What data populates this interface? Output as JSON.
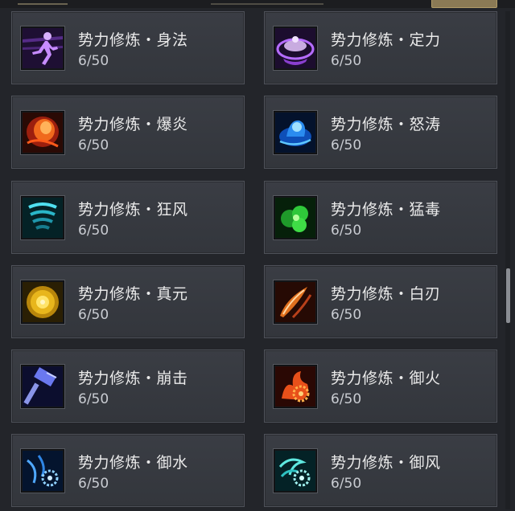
{
  "skills": [
    {
      "name": "势力修炼・身法",
      "progress": "6/50",
      "icon": "running-figure-icon",
      "color": "#a35ae0"
    },
    {
      "name": "势力修炼・定力",
      "progress": "6/50",
      "icon": "meditation-figure-icon",
      "color": "#9c4fd6"
    },
    {
      "name": "势力修炼・爆炎",
      "progress": "6/50",
      "icon": "flame-burst-icon",
      "color": "#e0481e"
    },
    {
      "name": "势力修炼・怒涛",
      "progress": "6/50",
      "icon": "wave-splash-icon",
      "color": "#1f7be6"
    },
    {
      "name": "势力修炼・狂风",
      "progress": "6/50",
      "icon": "whirlwind-icon",
      "color": "#26b5c9"
    },
    {
      "name": "势力修炼・猛毒",
      "progress": "6/50",
      "icon": "poison-cloud-icon",
      "color": "#34c43a"
    },
    {
      "name": "势力修炼・真元",
      "progress": "6/50",
      "icon": "golden-orb-icon",
      "color": "#e0b21c"
    },
    {
      "name": "势力修炼・白刃",
      "progress": "6/50",
      "icon": "blade-slash-icon",
      "color": "#d9621f"
    },
    {
      "name": "势力修炼・崩击",
      "progress": "6/50",
      "icon": "war-hammer-icon",
      "color": "#4b56d8"
    },
    {
      "name": "势力修炼・御火",
      "progress": "6/50",
      "icon": "fire-gear-icon",
      "color": "#e0561c"
    },
    {
      "name": "势力修炼・御水",
      "progress": "6/50",
      "icon": "water-gear-icon",
      "color": "#2f86e6"
    },
    {
      "name": "势力修炼・御风",
      "progress": "6/50",
      "icon": "wind-gear-icon",
      "color": "#2ec0c0"
    }
  ]
}
